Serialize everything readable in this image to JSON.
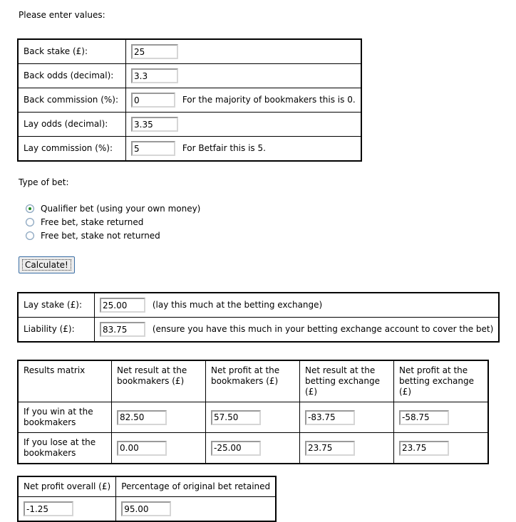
{
  "intro_label": "Please enter values:",
  "inputs_table": {
    "rows": [
      {
        "label": "Back stake (£):",
        "value": "25",
        "hint": ""
      },
      {
        "label": "Back odds (decimal):",
        "value": "3.3",
        "hint": ""
      },
      {
        "label": "Back commission (%):",
        "value": "0",
        "hint": "For the majority of bookmakers this is 0."
      },
      {
        "label": "Lay odds (decimal):",
        "value": "3.35",
        "hint": ""
      },
      {
        "label": "Lay commission (%):",
        "value": "5",
        "hint": "For Betfair this is 5."
      }
    ]
  },
  "bet_type": {
    "label": "Type of bet:",
    "options": [
      {
        "label": "Qualifier bet (using your own money)",
        "checked": true
      },
      {
        "label": "Free bet, stake returned",
        "checked": false
      },
      {
        "label": "Free bet, stake not returned",
        "checked": false
      }
    ]
  },
  "calculate_button": {
    "label": "Calculate!"
  },
  "lay_table": {
    "rows": [
      {
        "label": "Lay stake (£):",
        "value": "25.00",
        "hint": "(lay this much at the betting exchange)"
      },
      {
        "label": "Liability (£):",
        "value": "83.75",
        "hint": "(ensure you have this much in your betting exchange account to cover the bet)"
      }
    ]
  },
  "results_matrix": {
    "corner_label": "Results matrix",
    "columns": [
      "Net result at the bookmakers (£)",
      "Net profit at the bookmakers (£)",
      "Net result at the betting exchange (£)",
      "Net profit at the betting exchange (£)"
    ],
    "rows": [
      {
        "label": "If you win at the bookmakers",
        "values": [
          "82.50",
          "57.50",
          "-83.75",
          "-58.75"
        ]
      },
      {
        "label": "If you lose at the bookmakers",
        "values": [
          "0.00",
          "-25.00",
          "23.75",
          "23.75"
        ]
      }
    ]
  },
  "summary_table": {
    "columns": [
      "Net profit overall (£)",
      "Percentage of original bet retained"
    ],
    "values": [
      "-1.25",
      "95.00"
    ]
  },
  "colors": {
    "border": "#000000",
    "radio_selected": "#1f8a1f",
    "button_border": "#3a6ea5",
    "input_border": "#9a9a9a"
  }
}
